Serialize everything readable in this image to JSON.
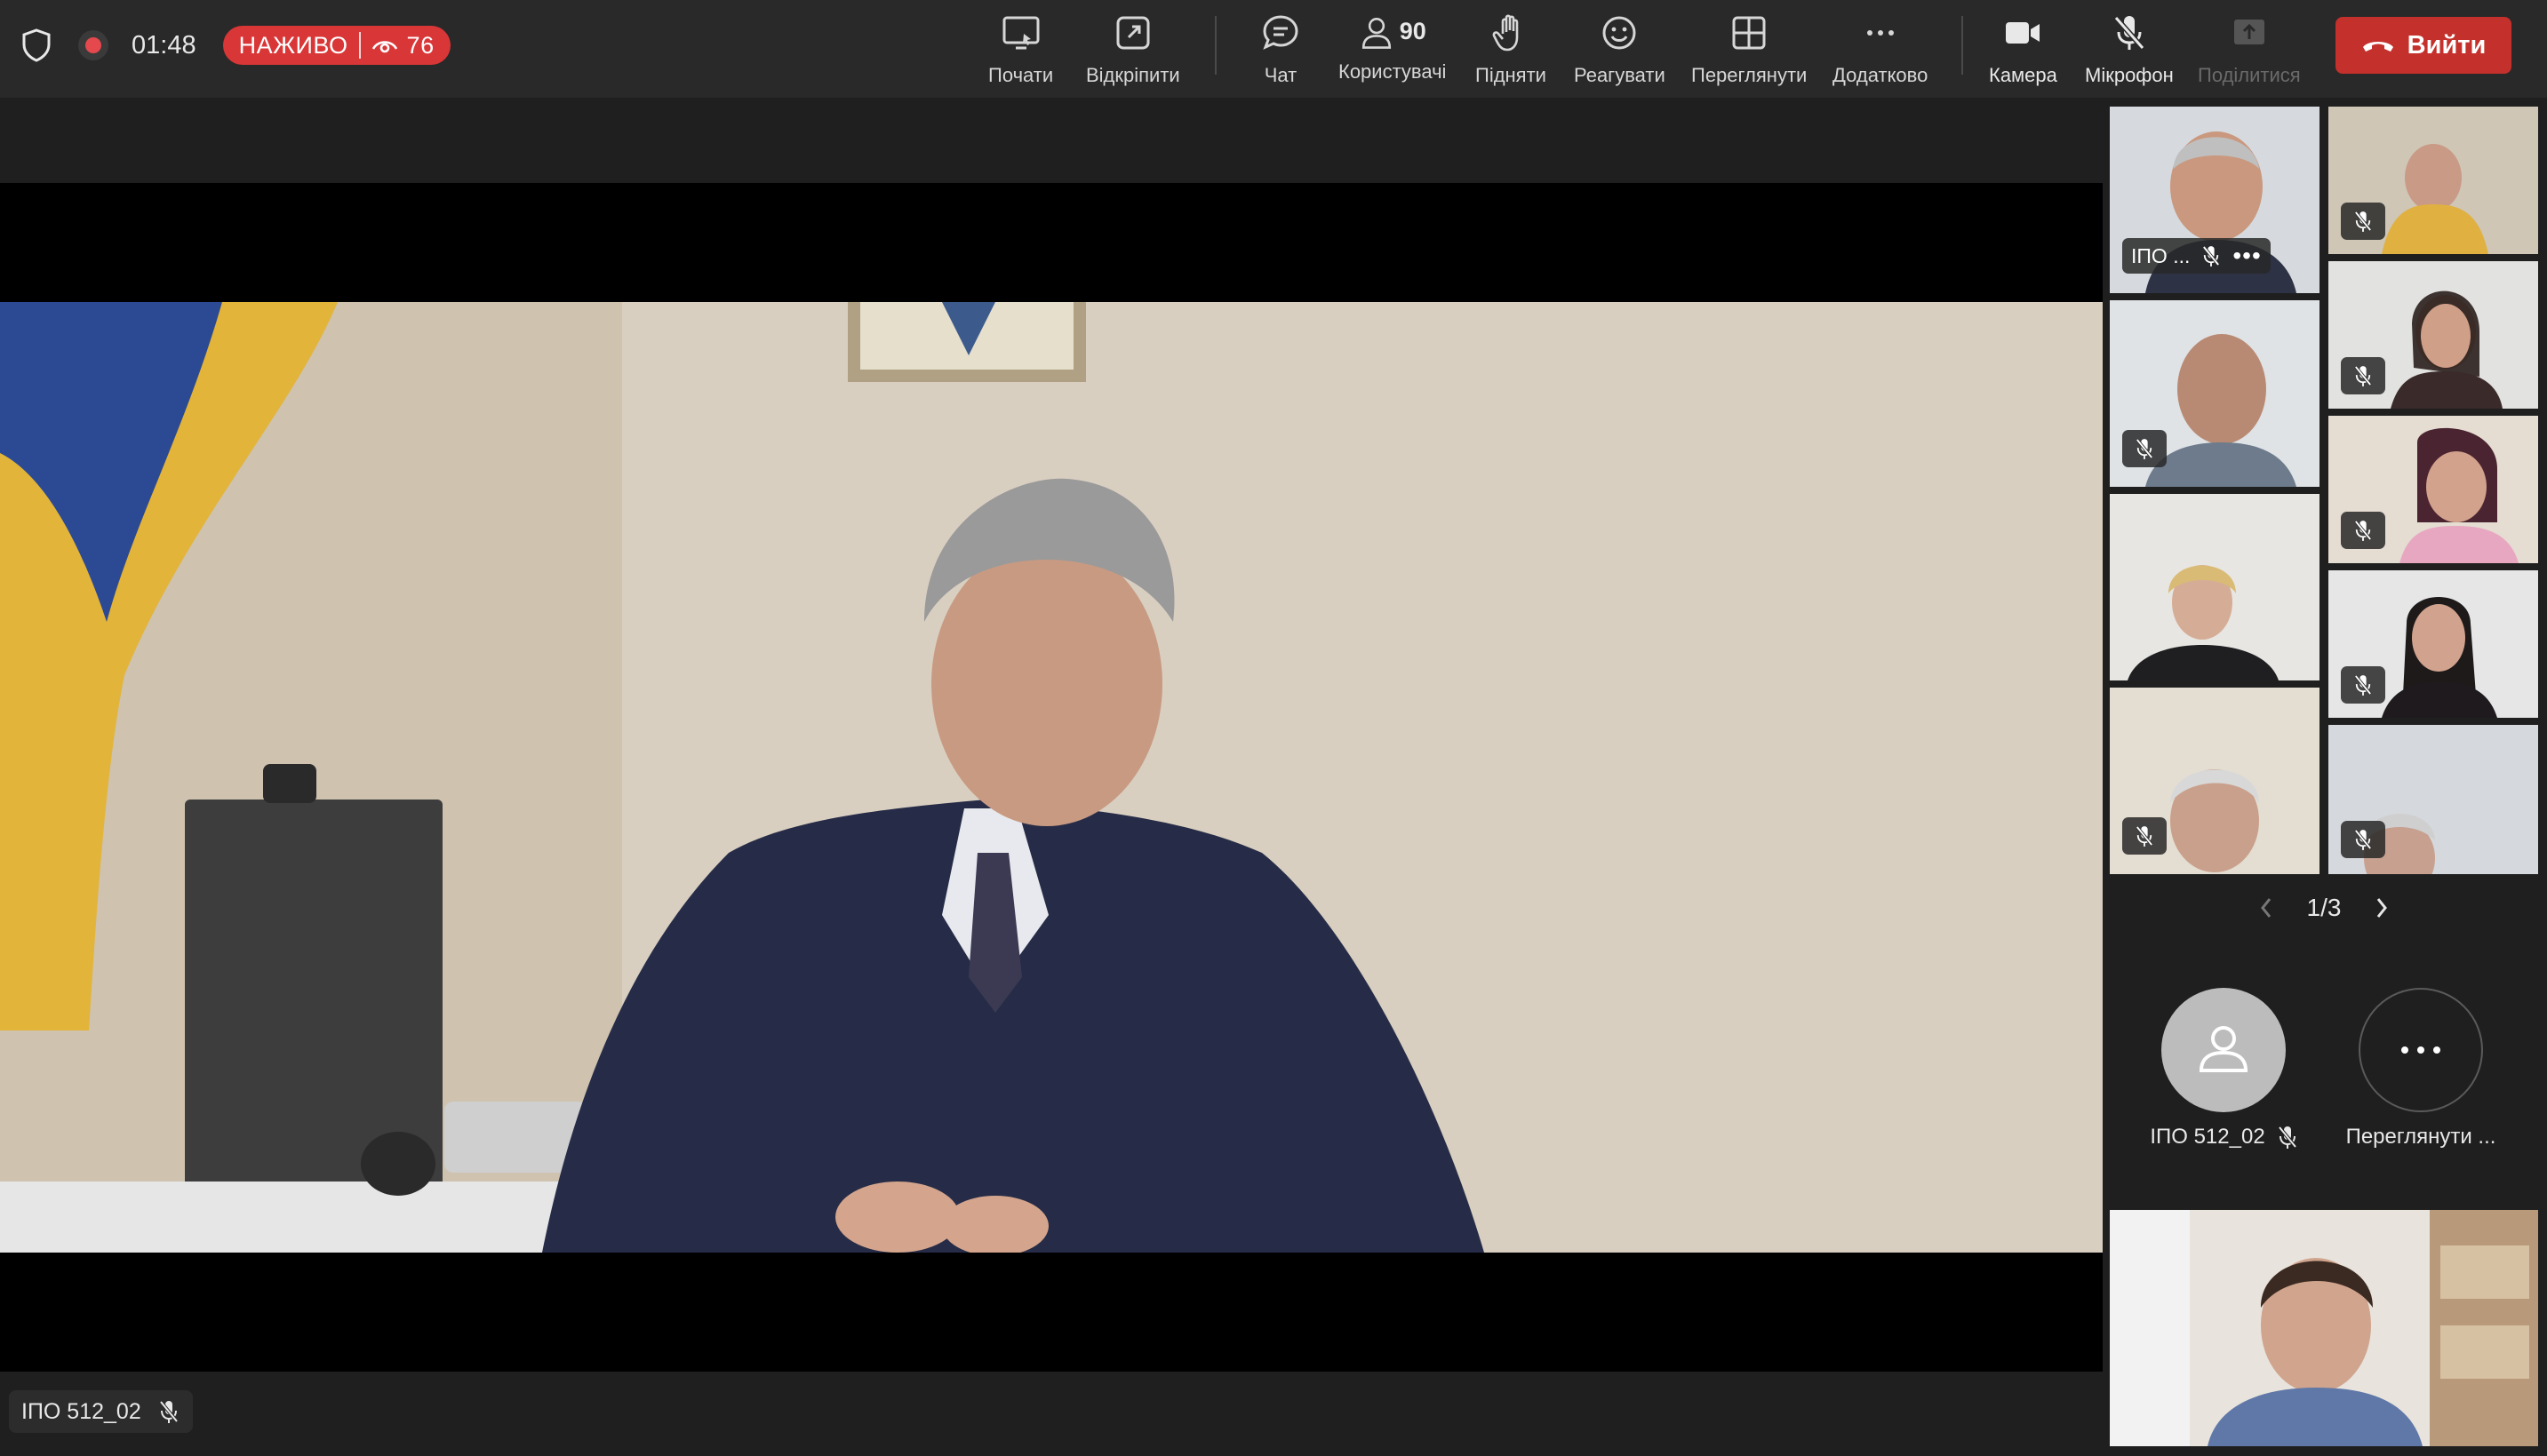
{
  "status": {
    "timer": "01:48",
    "live_label": "НАЖИВО",
    "viewer_count": "76"
  },
  "toolbar": {
    "share_label": "Почати",
    "popout_label": "Відкріпити",
    "chat_label": "Чат",
    "users_label": "Користувачі",
    "users_count": "90",
    "raise_label": "Підняти",
    "react_label": "Реагувати",
    "view_label": "Переглянути",
    "more_label": "Додатково",
    "camera_label": "Камера",
    "mic_label": "Мікрофон",
    "share_screen_label": "Поділитися",
    "leave_label": "Вийти"
  },
  "main": {
    "speaker_name": "ІПО 512_02"
  },
  "thumbnails": {
    "first_name": "ІПО ..."
  },
  "pager": {
    "page": "1/3"
  },
  "avatars": {
    "self_label": "ІПО 512_02",
    "more_label": "Переглянути ..."
  },
  "colors": {
    "accent_red": "#d93637",
    "leave_red": "#c4302b",
    "toolbar_bg": "#292929",
    "page_bg": "#1f1f1f"
  },
  "icons": [
    "shield-icon",
    "record-icon",
    "eye-icon",
    "share-screen-icon",
    "popout-icon",
    "chat-icon",
    "users-icon",
    "raise-hand-icon",
    "react-icon",
    "grid-view-icon",
    "more-icon",
    "camera-icon",
    "mic-muted-icon",
    "share-upload-icon",
    "hangup-icon",
    "user-avatar-icon",
    "chevron-left-icon",
    "chevron-right-icon"
  ]
}
